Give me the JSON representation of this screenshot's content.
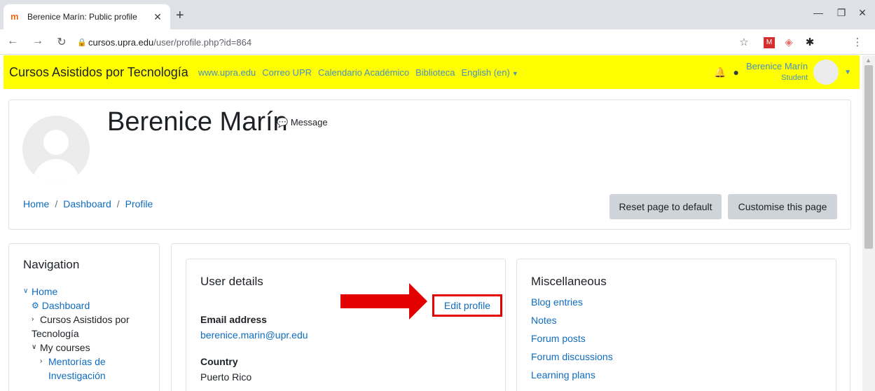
{
  "browser": {
    "tab_title": "Berenice Marín: Public profile",
    "tab_close": "✕",
    "new_tab": "+",
    "favicon": "m",
    "url_host": "cursos.upra.edu",
    "url_path": "/user/profile.php?id=864"
  },
  "navbar": {
    "brand": "Cursos Asistidos por Tecnología",
    "links": [
      "www.upra.edu",
      "Correo UPR",
      "Calendario Académico",
      "Biblioteca",
      "English (en)"
    ],
    "user_name": "Berenice Marín",
    "user_role": "Student"
  },
  "header": {
    "title": "Berenice Marín",
    "message": "Message",
    "breadcrumb": [
      "Home",
      "Dashboard",
      "Profile"
    ],
    "reset_button": "Reset page to default",
    "customise_button": "Customise this page"
  },
  "navigation": {
    "title": "Navigation",
    "home": "Home",
    "dashboard": "Dashboard",
    "site_line1": "Cursos Asistidos por",
    "site_line2": "Tecnología",
    "my_courses": "My courses",
    "course_line1": "Mentorías de",
    "course_line2": "Investigación"
  },
  "user_details": {
    "title": "User details",
    "edit_profile": "Edit profile",
    "email_label": "Email address",
    "email_value": "berenice.marin@upr.edu",
    "country_label": "Country",
    "country_value": "Puerto Rico"
  },
  "misc": {
    "title": "Miscellaneous",
    "links": [
      "Blog entries",
      "Notes",
      "Forum posts",
      "Forum discussions",
      "Learning plans"
    ]
  },
  "colors": {
    "navbar_bg": "#ffff00",
    "link": "#0f6cbf",
    "highlight": "#e30000"
  }
}
